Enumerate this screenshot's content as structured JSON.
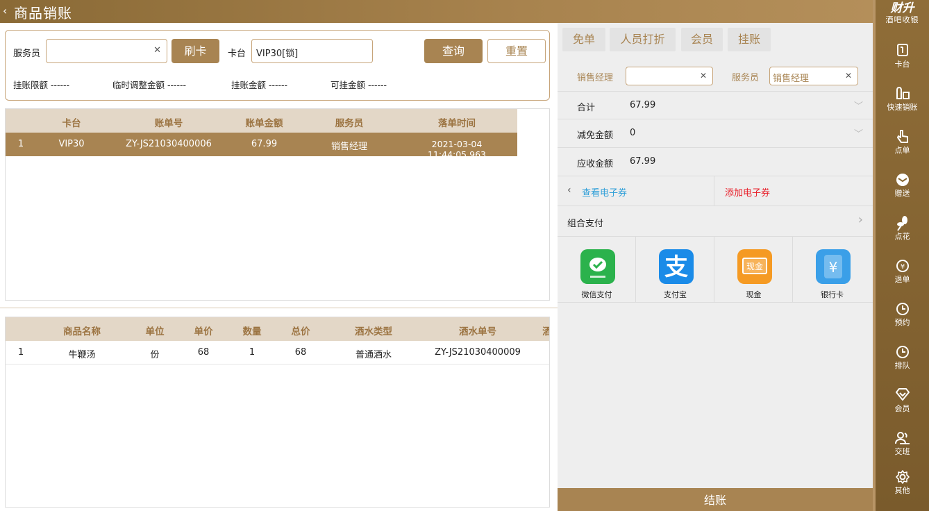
{
  "topbar": {
    "back_icon": "chevron-left-icon",
    "title": "商品销账"
  },
  "brand": {
    "name": "财升",
    "subtitle": "酒吧收银"
  },
  "sidebar": {
    "items": [
      {
        "label": "卡台",
        "icon": "table-card-icon"
      },
      {
        "label": "快速销账",
        "icon": "quick-writeoff-icon"
      },
      {
        "label": "点单",
        "icon": "order-hand-icon"
      },
      {
        "label": "赠送",
        "icon": "gift-icon"
      },
      {
        "label": "点花",
        "icon": "flower-icon"
      },
      {
        "label": "退单",
        "icon": "refund-icon"
      },
      {
        "label": "预约",
        "icon": "clock-icon"
      },
      {
        "label": "排队",
        "icon": "queue-clock-icon"
      },
      {
        "label": "会员",
        "icon": "diamond-icon"
      },
      {
        "label": "交班",
        "icon": "handover-icon"
      },
      {
        "label": "其他",
        "icon": "gear-icon"
      }
    ]
  },
  "filter": {
    "waiter_label": "服务员",
    "waiter_value": "",
    "swipe_label": "刷卡",
    "table_label": "卡台",
    "table_value": "VIP30[锁]",
    "query_label": "查询",
    "reset_label": "重置",
    "stats": [
      {
        "label": "挂账限额",
        "value": "------"
      },
      {
        "label": "临时调整金额",
        "value": "------"
      },
      {
        "label": "挂账金额",
        "value": "------"
      },
      {
        "label": "可挂金额",
        "value": "------"
      }
    ]
  },
  "bills": {
    "columns": [
      "卡台",
      "账单号",
      "账单金额",
      "服务员",
      "落单时间"
    ],
    "rows": [
      {
        "index": "1",
        "table": "VIP30",
        "bill_no": "ZY-JS21030400006",
        "amount": "67.99",
        "waiter": "销售经理",
        "time": "2021-03-04 11:44:05.963"
      }
    ]
  },
  "items": {
    "columns": [
      "商品名称",
      "单位",
      "单价",
      "数量",
      "总价",
      "酒水类型",
      "酒水单号",
      "酒"
    ],
    "rows": [
      {
        "index": "1",
        "name": "牛鞭汤",
        "unit": "份",
        "price": "68",
        "qty": "1",
        "total": "68",
        "type": "普通酒水",
        "no": "ZY-JS21030400009"
      }
    ]
  },
  "settle": {
    "tabs": [
      "免单",
      "人员打折",
      "会员",
      "挂账"
    ],
    "manager_label": "销售经理",
    "manager_value": "",
    "waiter_label": "服务员",
    "waiter_value": "销售经理",
    "total_label": "合计",
    "total_value": "67.99",
    "discount_label": "减免金额",
    "discount_value": "0",
    "due_label": "应收金额",
    "due_value": "67.99",
    "view_coupon": "查看电子券",
    "add_coupon": "添加电子券",
    "combo_pay": "组合支付",
    "payments": [
      {
        "label": "微信支付",
        "icon": "wechat-pay-icon",
        "color": "#2bb24c"
      },
      {
        "label": "支付宝",
        "icon": "alipay-icon",
        "color": "#1a8be8"
      },
      {
        "label": "现金",
        "icon": "cash-icon",
        "color": "#f59a23"
      },
      {
        "label": "银行卡",
        "icon": "bank-card-icon",
        "color": "#3a9fe8"
      }
    ],
    "checkout": "结账"
  },
  "colors": {
    "accent": "#a88452",
    "header_bg": "#e3d7c7",
    "coupon_add": "#e8202a",
    "coupon_view": "#2f9fd8"
  }
}
